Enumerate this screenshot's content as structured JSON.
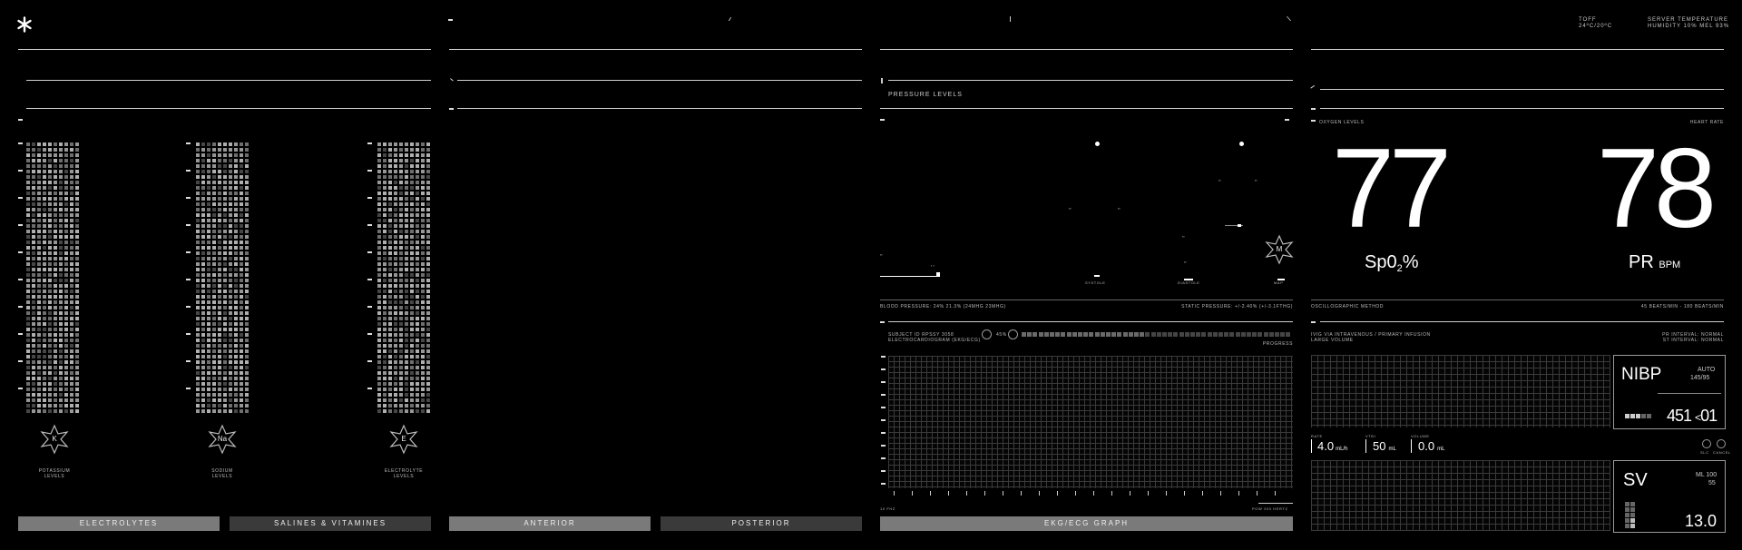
{
  "header": {
    "temp_code": "TOFF",
    "temp_range": "24ºC/20ºC",
    "server_temp_label": "SERVER TEMPERATURE",
    "humidity_label": "HUMIDITY 10% MEL 93%"
  },
  "panel1": {
    "emblems": [
      {
        "symbol": "K",
        "label_line1": "POTASSIUM",
        "label_line2": "LEVELS"
      },
      {
        "symbol": "Na",
        "label_line1": "SODIUM",
        "label_line2": "LEVELS"
      },
      {
        "symbol": "E",
        "label_line1": "ELECTROLYTE",
        "label_line2": "LEVELS"
      }
    ],
    "tabs": [
      "ELECTROLYTES",
      "SALINES & VITAMINES"
    ]
  },
  "panel2": {
    "tabs": [
      "ANTERIOR",
      "POSTERIOR"
    ]
  },
  "panel3": {
    "title": "PRESSURE LEVELS",
    "emblem_symbol": "M",
    "bp_label": "BLOOD PRESSURE: 24% 21.3% (24MHG 23MHG)",
    "static_label": "STATIC PRESSURE: +/-2.40% (+/-3.1FTHG)",
    "subject_line1": "SUBJECT ID RPSSY 3058",
    "subject_line2": "ELECTROCARDIOGRAM (EKG/ECG)",
    "progress_pct": "45%",
    "progress_label": "PROGRESS",
    "progress_value": 0.45,
    "tab": "EKG/ECG GRAPH",
    "peak_labels": [
      "SYSTOLE",
      "DIASTOLE",
      "MEAN",
      "MAP"
    ],
    "bottom_left_label": "10 FHZ",
    "bottom_right_label": "POW 200 HERTZ"
  },
  "panel4": {
    "oxygen_label": "OXYGEN LEVELS",
    "heart_label": "HEART RATE",
    "spo2_value": "77",
    "spo2_label": "Sp0",
    "spo2_sub": "2",
    "spo2_pct": "%",
    "pr_value": "78",
    "pr_label": "PR",
    "pr_unit": "BPM",
    "osc_label": "OSCILLOGRAPHIC METHOD",
    "osc_right": "45 BEATS/MIN - 180 BEATS/MIN",
    "iv_line1": "IVIG VIA INTRAVENOUS / PRIMARY INFUSION",
    "iv_line2": "LARGE VOLUME",
    "interval_line1": "PR INTERVAL: NORMAL",
    "interval_line2": "ST INTERVAL: NORMAL",
    "rate_label": "RATE",
    "rate_value": "4.0",
    "rate_unit": "mL/h",
    "vtbi_label": "VTBI",
    "vtbi_value": "50",
    "vtbi_unit": "mL",
    "volume_label": "VOLUME",
    "volume_value": "0.0",
    "volume_unit": "mL",
    "nibp_title": "NIBP",
    "nibp_mode": "AUTO",
    "nibp_range": "145/95",
    "nibp_value": "451 ",
    "nibp_value2": "01",
    "nibp_arrow": "<",
    "btn1_label": "SLC",
    "btn2_label": "CANCEL",
    "sv_title": "SV",
    "sv_ml": "ML 100",
    "sv_sub": "55",
    "sv_value": "13.0"
  }
}
